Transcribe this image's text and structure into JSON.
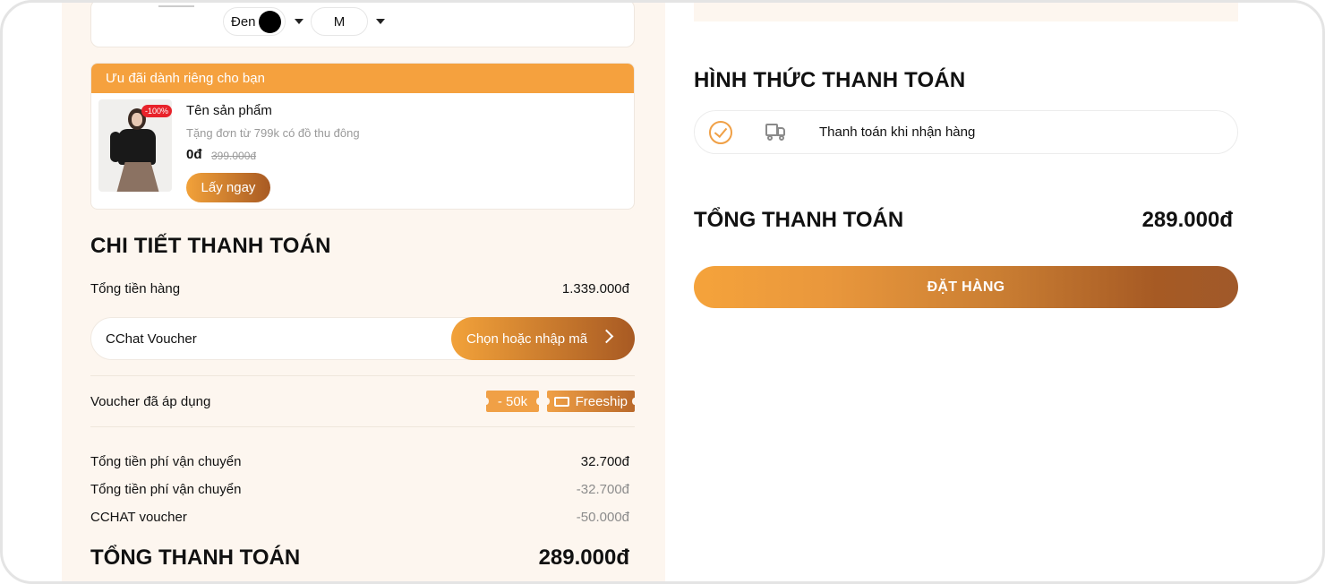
{
  "cart_item": {
    "color_value": "Đen",
    "size_value": "M"
  },
  "offer": {
    "header": "Ưu đãi dành riêng cho bạn",
    "discount_badge": "-100%",
    "product_name": "Tên sản phẩm",
    "product_sub": "Tặng đơn từ 799k có đồ thu đông",
    "price": "0đ",
    "old_price": "399.000đ",
    "cta": "Lấy ngay"
  },
  "payment_details": {
    "title": "CHI TIẾT THANH TOÁN",
    "subtotal_label": "Tổng tiền hàng",
    "subtotal_value": "1.339.000đ",
    "voucher_label": "CChat Voucher",
    "voucher_button": "Chọn hoặc nhập mã",
    "applied_label": "Voucher đã áp dụng",
    "applied_tags": [
      "- 50k",
      "Freeship"
    ],
    "shipping_label": "Tổng tiền phí vận chuyển",
    "shipping_value": "32.700đ",
    "shipping_discount_label": "Tổng tiền phí vận chuyển",
    "shipping_discount_value": "-32.700đ",
    "cchat_voucher_label": "CCHAT voucher",
    "cchat_voucher_value": "-50.000đ",
    "total_label": "TỔNG THANH TOÁN",
    "total_value": "289.000đ"
  },
  "payment_method": {
    "title": "HÌNH THỨC THANH TOÁN",
    "option_label": "Thanh toán khi nhận hàng",
    "option_icon": "truck-icon",
    "selected_icon": "check-circle-icon"
  },
  "summary": {
    "total_label": "TỔNG THANH TOÁN",
    "total_value": "289.000đ",
    "order_button": "ĐẶT HÀNG"
  },
  "colors": {
    "accent": "#f5a13e",
    "accent_dark": "#a65a24",
    "panel_bg": "#fdf6ef"
  }
}
